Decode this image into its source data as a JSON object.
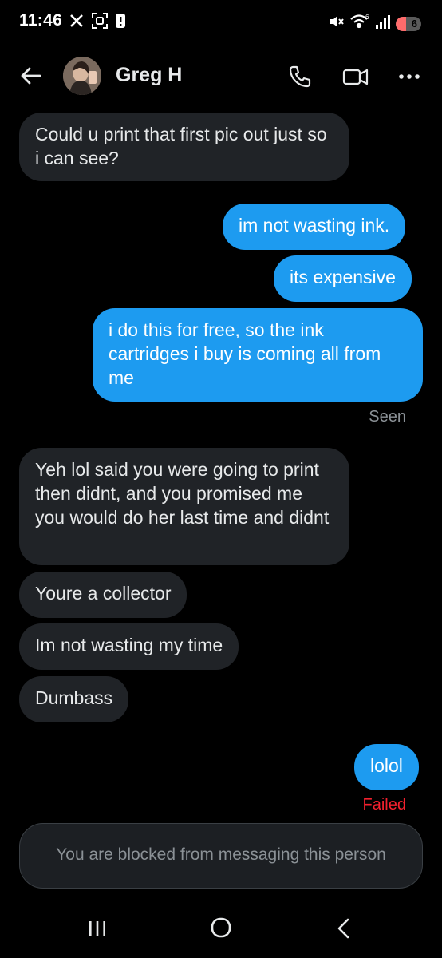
{
  "status_bar": {
    "time": "11:46",
    "battery_level": "6",
    "network": "6"
  },
  "header": {
    "contact_name": "Greg H",
    "icons": [
      "back-arrow-icon",
      "phone-icon",
      "video-icon",
      "more-icon"
    ]
  },
  "messages": [
    {
      "side": "in",
      "text": "Could u print that first pic out just so i can see?"
    },
    {
      "side": "out",
      "text": "im not wasting ink."
    },
    {
      "side": "out",
      "text": "its expensive"
    },
    {
      "side": "out",
      "text": "i do this for free, so the ink cartridges i buy is coming all from me"
    },
    {
      "side": "in",
      "text": "Yeh lol said you were going to print then didnt, and you promised me you would do her last time and didnt"
    },
    {
      "side": "in",
      "text": "Youre a collector"
    },
    {
      "side": "in",
      "text": "Im not wasting my time"
    },
    {
      "side": "in",
      "text": "Dumbass"
    },
    {
      "side": "out",
      "text": "lolol"
    }
  ],
  "seen_label": "Seen",
  "failed_label": "Failed",
  "composer": {
    "blocked_text": "You are blocked from messaging this person"
  },
  "colors": {
    "outgoing_bubble": "#1d9bf0",
    "incoming_bubble": "#202327",
    "failed_text": "#f4212e"
  }
}
